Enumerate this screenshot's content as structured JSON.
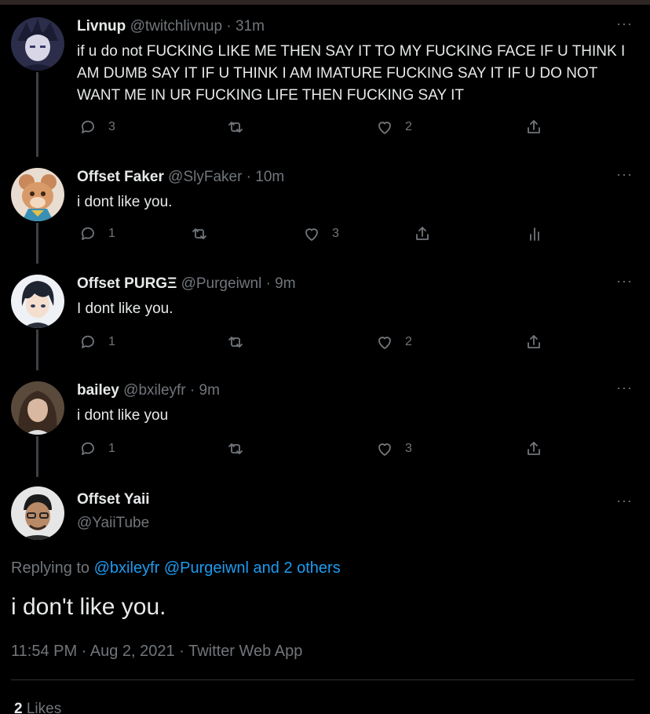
{
  "tweets": [
    {
      "name": "Livnup",
      "handle": "@twitchlivnup · 31m",
      "text": "if u do not FUCKING LIKE ME THEN SAY IT TO MY FUCKING FACE IF U THINK I AM DUMB SAY IT IF U THINK I AM IMATURE FUCKING SAY IT IF U DO NOT WANT ME IN UR FUCKING LIFE THEN FUCKING SAY IT",
      "replies": "3",
      "likes": "2",
      "more": "···"
    },
    {
      "name": "Offset Faker",
      "handle": "@SlyFaker · 10m",
      "text": "i dont like you.",
      "replies": "1",
      "likes": "3",
      "more": "···"
    },
    {
      "name": "Offset PURGΞ",
      "handle": "@Purgeiwnl · 9m",
      "text": "I dont like you.",
      "replies": "1",
      "likes": "2",
      "more": "···"
    },
    {
      "name": "bailey",
      "handle": "@bxileyfr · 9m",
      "text": "i dont like you",
      "replies": "1",
      "likes": "3",
      "more": "···"
    }
  ],
  "main": {
    "name": "Offset Yaii",
    "handle": "@YaiiTube",
    "more": "···",
    "replying_prefix": "Replying to ",
    "replying_links": "@bxileyfr @Purgeiwnl and 2 others",
    "text": "i don't like you.",
    "meta": "11:54 PM · Aug 2, 2021 · Twitter Web App",
    "likes_count": "2",
    "likes_label": " Likes"
  },
  "icons": [
    "reply-icon",
    "retweet-icon",
    "like-icon",
    "share-icon",
    "analytics-icon"
  ],
  "colors": {
    "background": "#000000",
    "link": "#1d9bf0",
    "muted": "#71767b"
  }
}
